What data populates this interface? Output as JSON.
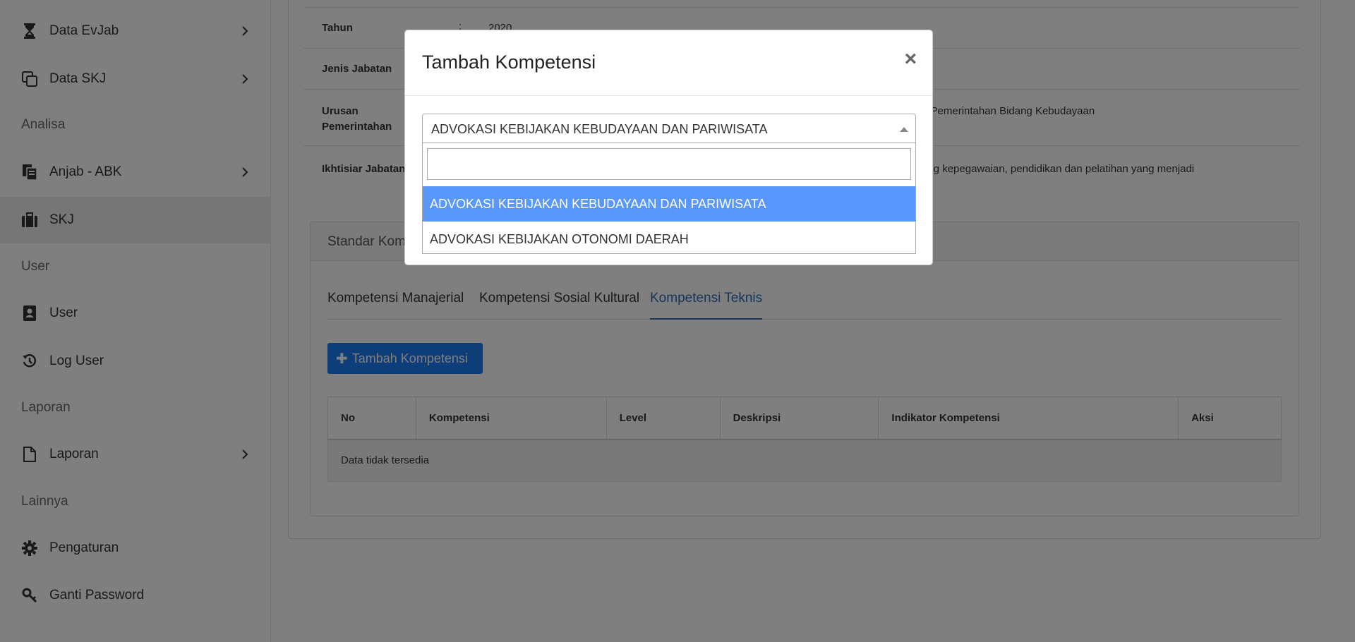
{
  "sidebar": {
    "items": [
      {
        "label": "Data EvJab",
        "icon": "hourglass-icon",
        "has_children": true
      },
      {
        "label": "Data SKJ",
        "icon": "copy-icon",
        "has_children": true
      },
      {
        "label": "Anjab - ABK",
        "icon": "documents-icon",
        "has_children": true
      },
      {
        "label": "SKJ",
        "icon": "briefcase-icon",
        "has_children": false,
        "active": true
      },
      {
        "label": "User",
        "icon": "address-book-icon",
        "has_children": false
      },
      {
        "label": "Log User",
        "icon": "history-icon",
        "has_children": false
      },
      {
        "label": "Laporan",
        "icon": "file-icon",
        "has_children": true
      },
      {
        "label": "Pengaturan",
        "icon": "gear-icon",
        "has_children": false
      },
      {
        "label": "Ganti Password",
        "icon": "key-icon",
        "has_children": false
      }
    ],
    "sections": {
      "analisa": "Analisa",
      "user": "User",
      "laporan": "Laporan",
      "lainnya": "Lainnya"
    }
  },
  "info": {
    "tahun_label": "Tahun",
    "tahun_colon": ":",
    "tahun_value": "2020",
    "jenis_label": "Jenis Jabatan",
    "urusan_label_1": "Urusan",
    "urusan_label_2": "Pemerintahan",
    "urusan_value": "n Pemerintahan Bidang Kebudayaan",
    "ikhtisiar_label": "Ikhtisiar Jabatan",
    "ikhtisiar_value": "ang kepegawaian, pendidikan dan pelatihan yang menjadi"
  },
  "skj_panel": {
    "header": "Standar Kompetensi"
  },
  "tabs": [
    {
      "label": "Kompetensi Manajerial",
      "active": false
    },
    {
      "label": "Kompetensi Sosial Kultural",
      "active": false
    },
    {
      "label": "Kompetensi Teknis",
      "active": true
    }
  ],
  "add_button": {
    "label": "Tambah Kompetensi"
  },
  "table": {
    "headers": [
      "No",
      "Kompetensi",
      "Level",
      "Deskripsi",
      "Indikator Kompetensi",
      "Aksi"
    ],
    "empty_text": "Data tidak tersedia"
  },
  "modal": {
    "title": "Tambah Kompetensi",
    "close": "×",
    "selected": "ADVOKASI KEBIJAKAN KEBUDAYAAN DAN PARIWISATA",
    "search_value": "",
    "options": [
      {
        "label": "ADVOKASI KEBIJAKAN KEBUDAYAAN DAN PARIWISATA",
        "highlighted": true
      },
      {
        "label": "ADVOKASI KEBIJAKAN OTONOMI DAERAH",
        "highlighted": false
      }
    ]
  },
  "colors": {
    "accent": "#1a7cf4",
    "tab_active": "#2a6ab7",
    "option_highlight": "#5897fb",
    "backdrop": "rgba(0,0,0,0.5)"
  }
}
